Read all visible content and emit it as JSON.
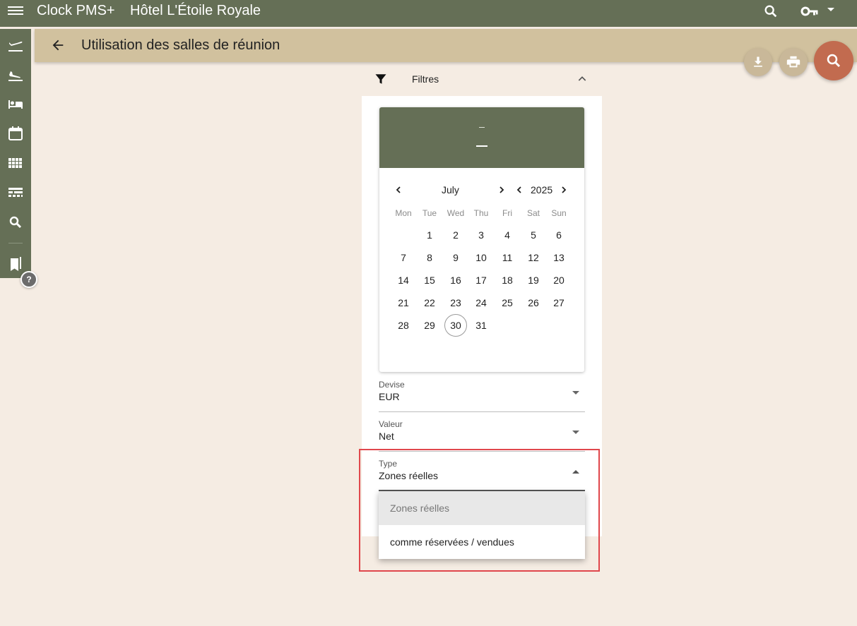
{
  "appbar": {
    "app_name": "Clock PMS+",
    "hotel_name": "Hôtel L'Étoile Royale"
  },
  "page": {
    "title": "Utilisation des salles de réunion"
  },
  "filters": {
    "label": "Filtres"
  },
  "calendar": {
    "header_day": "–",
    "header_date": "–",
    "month": "July",
    "year": "2025",
    "weekdays": [
      "Mon",
      "Tue",
      "Wed",
      "Thu",
      "Fri",
      "Sat",
      "Sun"
    ],
    "weeks": [
      [
        "",
        "1",
        "2",
        "3",
        "4",
        "5",
        "6"
      ],
      [
        "7",
        "8",
        "9",
        "10",
        "11",
        "12",
        "13"
      ],
      [
        "14",
        "15",
        "16",
        "17",
        "18",
        "19",
        "20"
      ],
      [
        "21",
        "22",
        "23",
        "24",
        "25",
        "26",
        "27"
      ],
      [
        "28",
        "29",
        "30",
        "31",
        "",
        "",
        ""
      ]
    ],
    "today": "30"
  },
  "fields": {
    "currency": {
      "label": "Devise",
      "value": "EUR"
    },
    "value": {
      "label": "Valeur",
      "value": "Net"
    },
    "type": {
      "label": "Type",
      "value": "Zones réelles"
    }
  },
  "type_options": [
    "Zones réelles",
    "comme réservées / vendues"
  ],
  "colors": {
    "primary": "#656f56",
    "secondary": "#d1c19e",
    "accent": "#c26b4f",
    "background": "#f5ece3",
    "highlight": "#e0474c"
  }
}
